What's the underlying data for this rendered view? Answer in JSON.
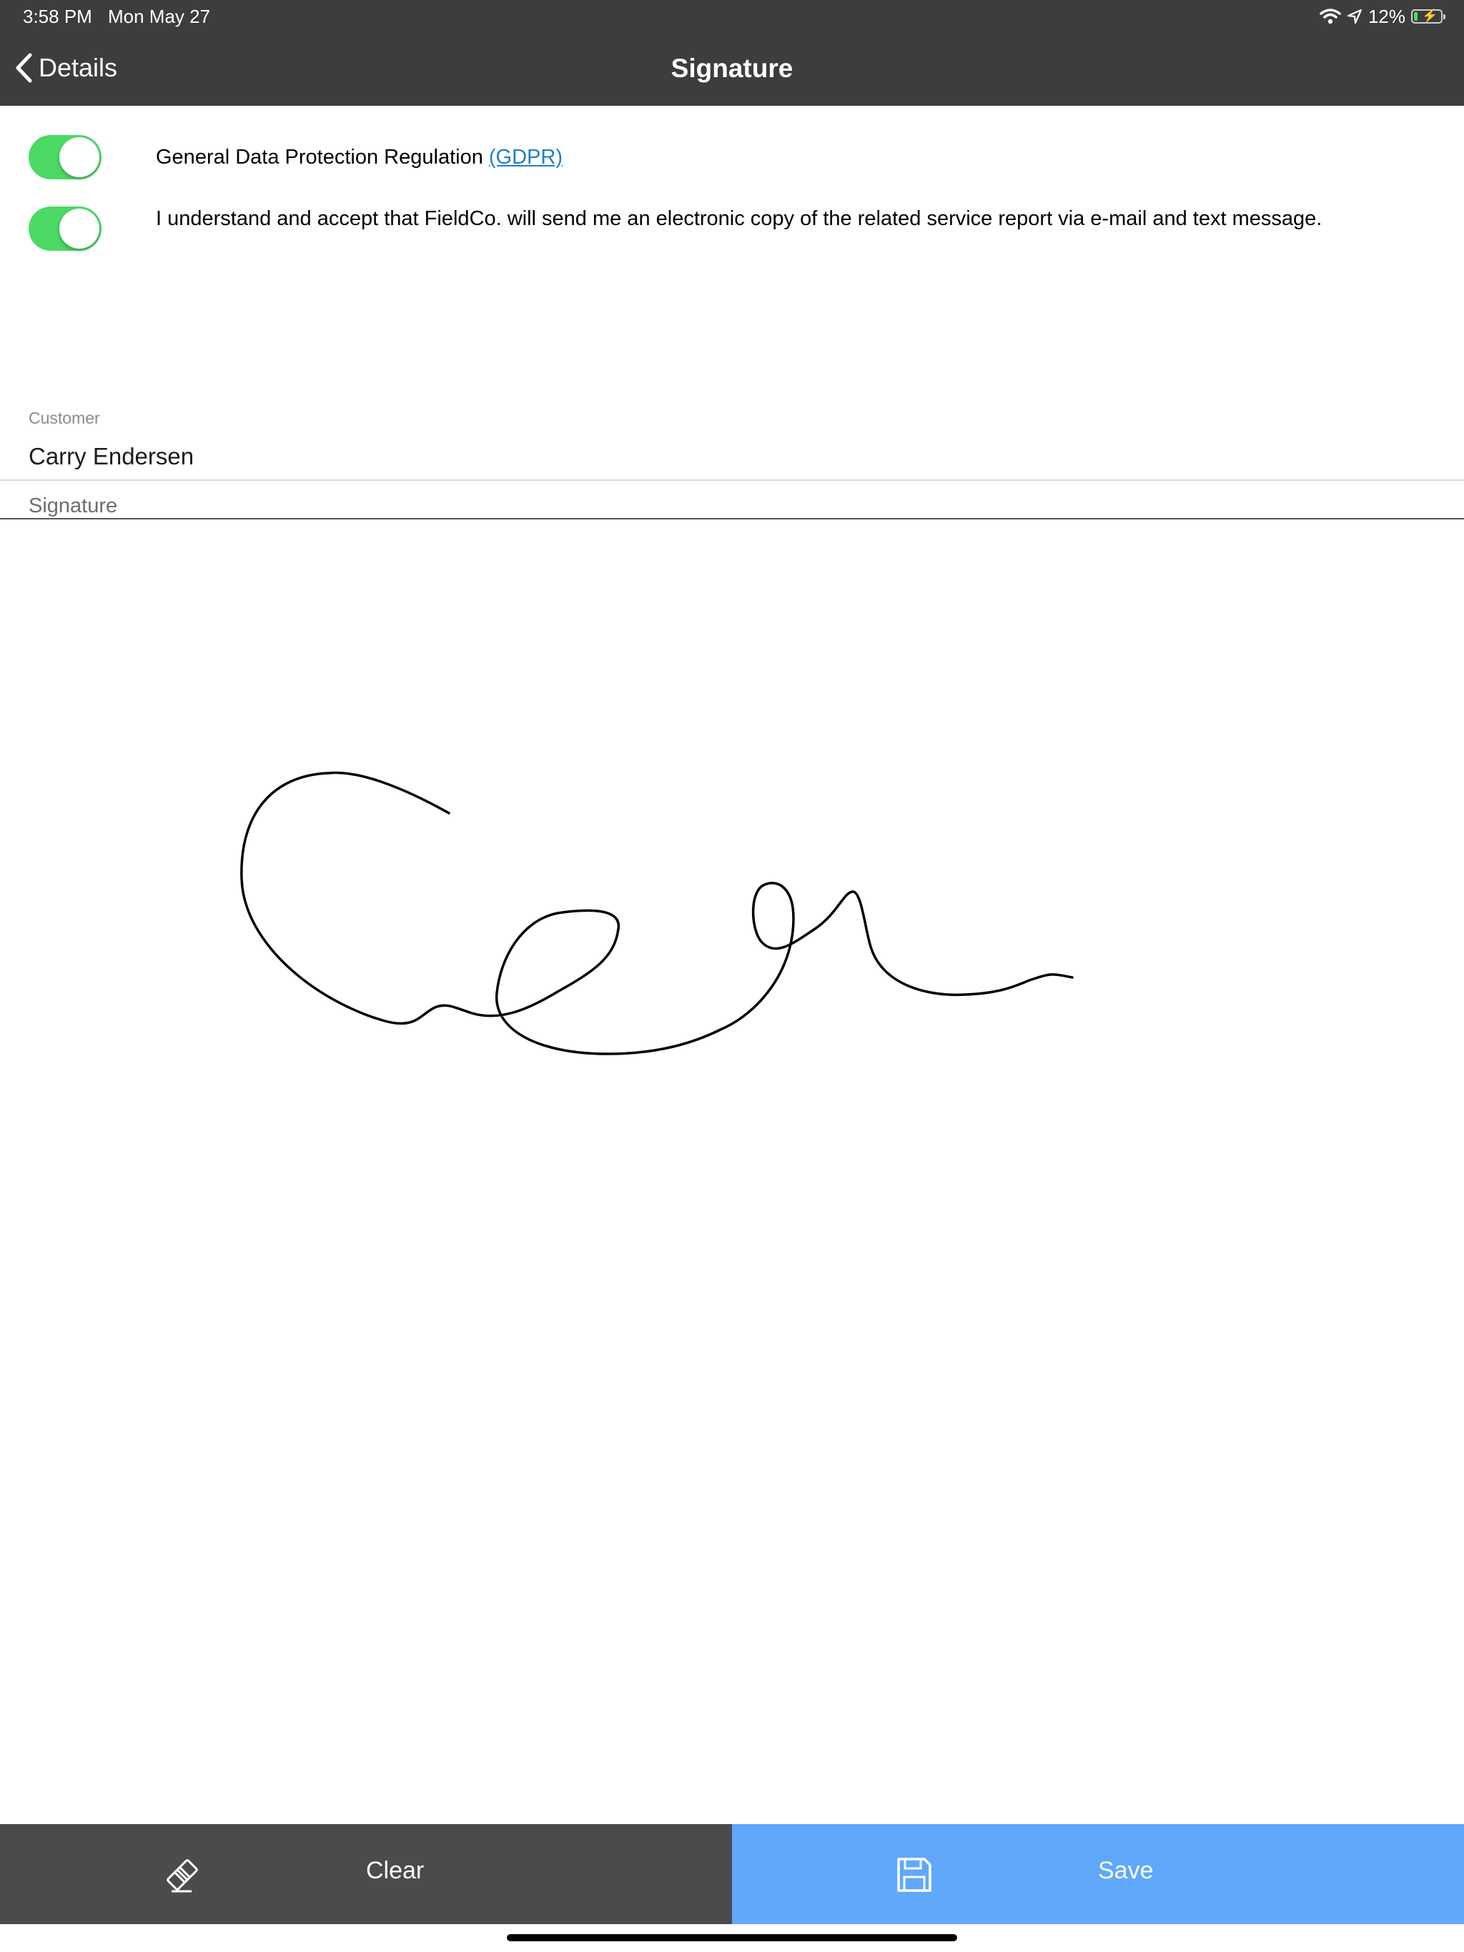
{
  "status_bar": {
    "time": "3:58 PM",
    "date": "Mon May 27",
    "battery": "12%",
    "battery_level": 0.12
  },
  "nav": {
    "back_label": "Details",
    "title": "Signature"
  },
  "toggles": [
    {
      "text": "General Data Protection Regulation ",
      "link": "(GDPR)",
      "on": true
    },
    {
      "text": "I understand and accept that FieldCo. will send me an electronic copy of the related service report via e-mail and text message.",
      "on": true
    }
  ],
  "customer": {
    "label": "Customer",
    "value": "Carry Endersen"
  },
  "signature": {
    "label": "Signature"
  },
  "toolbar": {
    "clear_label": "Clear",
    "save_label": "Save"
  },
  "colors": {
    "nav_background": "#3c3d3c",
    "toggle_on": "#4cd964",
    "link": "#1f7fc8",
    "clear_background": "#4a4b4c",
    "save_background": "#5fa8fc"
  },
  "icons": {
    "back": "chevron-left-icon",
    "wifi": "wifi-icon",
    "location": "location-arrow-icon",
    "battery": "battery-charging-icon",
    "clear": "eraser-icon",
    "save": "floppy-disk-icon"
  }
}
